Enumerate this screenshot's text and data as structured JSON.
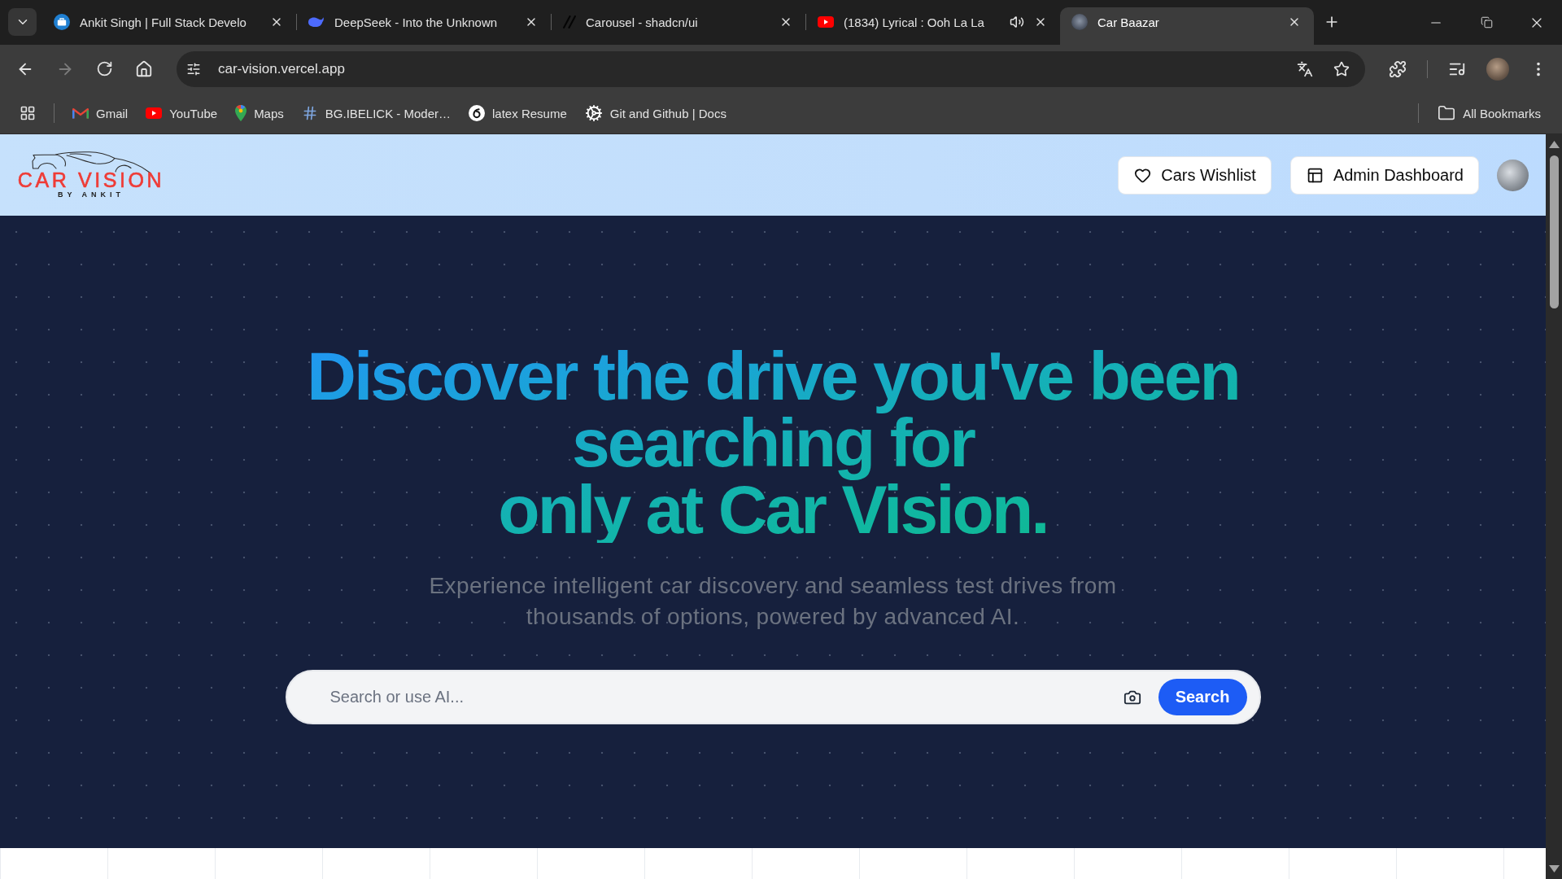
{
  "browser": {
    "tabs": [
      {
        "title": "Ankit Singh | Full Stack Develo",
        "selected": false,
        "playing_audio": false
      },
      {
        "title": "DeepSeek - Into the Unknown",
        "selected": false,
        "playing_audio": false
      },
      {
        "title": "Carousel - shadcn/ui",
        "selected": false,
        "playing_audio": false
      },
      {
        "title": "(1834) Lyrical : Ooh La La",
        "selected": false,
        "playing_audio": true
      },
      {
        "title": "Car Baazar",
        "selected": true,
        "playing_audio": false
      }
    ],
    "forward_disabled": true,
    "address": "car-vision.vercel.app",
    "bookmarks": [
      "Gmail",
      "YouTube",
      "Maps",
      "BG.IBELICK - Moder…",
      "latex Resume",
      "Git and Github | Docs"
    ],
    "all_bookmarks": "All Bookmarks"
  },
  "header": {
    "logo": {
      "title": "CAR VISION",
      "tagline": "BY ANKIT"
    },
    "buttons": [
      "Cars Wishlist",
      "Admin Dashboard"
    ]
  },
  "hero": {
    "title_lines": [
      "Discover the drive you've been",
      "searching for",
      "only at Car Vision."
    ],
    "subtitle": "Experience intelligent car discovery and seamless test drives from thousands of options, powered by advanced AI.",
    "search": {
      "placeholder": "Search or use AI...",
      "button": "Search"
    }
  }
}
